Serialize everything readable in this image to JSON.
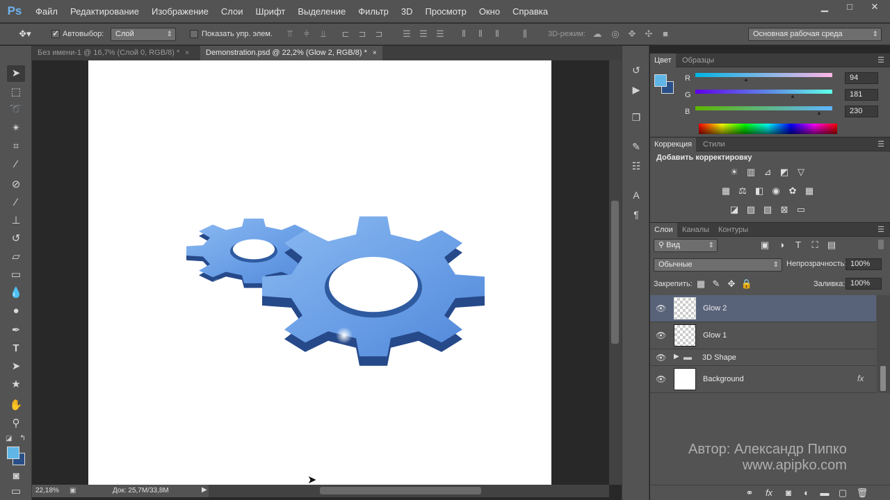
{
  "app": {
    "logo": "Ps"
  },
  "menu": [
    "Файл",
    "Редактирование",
    "Изображение",
    "Слои",
    "Шрифт",
    "Выделение",
    "Фильтр",
    "3D",
    "Просмотр",
    "Окно",
    "Справка"
  ],
  "window_controls": {
    "minimize": "▁",
    "maximize": "□",
    "close": "✕"
  },
  "options_bar": {
    "auto_select_label": "Автовыбор:",
    "auto_select_checked": true,
    "auto_select_target": "Слой",
    "show_transform_label": "Показать упр. элем.",
    "mode_3d_label": "3D-режим:",
    "workspace": "Основная рабочая среда"
  },
  "tabs": [
    {
      "label": "Без имени-1 @ 16,7% (Слой 0, RGB/8) *",
      "close": "×"
    },
    {
      "label": "Demonstration.psd @ 22,2% (Glow 2, RGB/8) *",
      "close": "×",
      "active": true
    }
  ],
  "status": {
    "zoom": "22,18%",
    "doc": "Док: 25,7M/33,8M"
  },
  "color_panel": {
    "tabs": [
      "Цвет",
      "Образцы"
    ],
    "r_label": "R",
    "r_value": "94",
    "g_label": "G",
    "g_value": "181",
    "b_label": "B",
    "b_value": "230",
    "foreground": "#5eb5e6",
    "background": "#2a4f86"
  },
  "adjustments_panel": {
    "tabs": [
      "Коррекция",
      "Стили"
    ],
    "title": "Добавить корректировку"
  },
  "layers_panel": {
    "tabs": [
      "Слои",
      "Каналы",
      "Контуры"
    ],
    "filter": "Вид",
    "blend_mode": "Обычные",
    "opacity_label": "Непрозрачность:",
    "opacity": "100%",
    "lock_label": "Закрепить:",
    "fill_label": "Заливка:",
    "fill": "100%",
    "layers": [
      {
        "name": "Glow 2",
        "selected": true
      },
      {
        "name": "Glow 1"
      },
      {
        "name": "3D Shape"
      },
      {
        "name": "Background",
        "fx": "fx"
      }
    ]
  },
  "watermark": {
    "line1": "Автор: Александр Пипко",
    "line2": "www.apipko.com"
  },
  "colors": {
    "gear_light": "#7fb0ee",
    "gear_dark": "#2e5aa0",
    "accent": "#58637a"
  }
}
